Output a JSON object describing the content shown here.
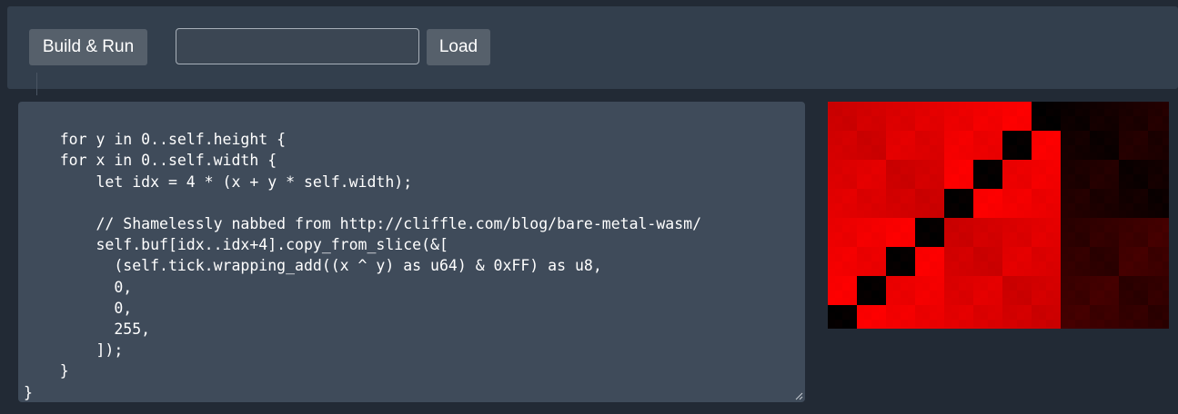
{
  "toolbar": {
    "run_label": "Build & Run",
    "url_input_value": "",
    "url_input_placeholder": "",
    "load_label": "Load"
  },
  "editor": {
    "code": "for y in 0..self.height {\n    for x in 0..self.width {\n        let idx = 4 * (x + y * self.width);\n\n        // Shamelessly nabbed from http://cliffle.com/blog/bare-metal-wasm/\n        self.buf[idx..idx+4].copy_from_slice(&[\n          (self.tick.wrapping_add((x ^ y) as u64) & 0xFF) as u8,\n          0,\n          0,\n          255,\n        ]);\n    }\n}"
  },
  "canvas": {
    "description_icon": "xor-pattern-canvas",
    "base_color": "#ff0000",
    "dark_color": "#000000"
  }
}
